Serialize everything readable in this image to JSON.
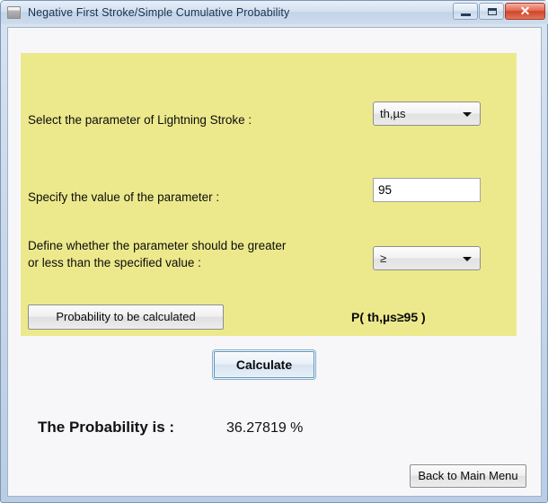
{
  "window": {
    "title": "Negative First Stroke/Simple Cumulative Probability",
    "icon": "app-window-icon",
    "controls": {
      "minimize": "–",
      "maximize": "□",
      "close": "✕"
    }
  },
  "form": {
    "parameter_row": {
      "label": "Select the parameter of Lightning Stroke :",
      "combo_value": "th,µs",
      "combo_arrow": "chevron-down-icon"
    },
    "value_row": {
      "label": "Specify the value of the parameter :",
      "input_value": "95",
      "input_placeholder": ""
    },
    "operator_row": {
      "label_line1": "Define whether the parameter should be greater",
      "label_line2": "or less than the specified value :",
      "combo_value": "≥",
      "combo_arrow": "chevron-down-icon"
    },
    "probability_button": "Probability to be calculated",
    "probability_expression": "P( th,µs≥95 )"
  },
  "actions": {
    "calculate": "Calculate",
    "back_to_main_menu": "Back to Main Menu"
  },
  "result": {
    "label": "The Probability is :",
    "value": "36.27819 %"
  },
  "colors": {
    "panel_bg": "#ece98c",
    "panel_cap": "#eeeb98",
    "client_bg": "#f7f7fa",
    "close_button": "#cf4526",
    "title_text": "#16314f"
  }
}
